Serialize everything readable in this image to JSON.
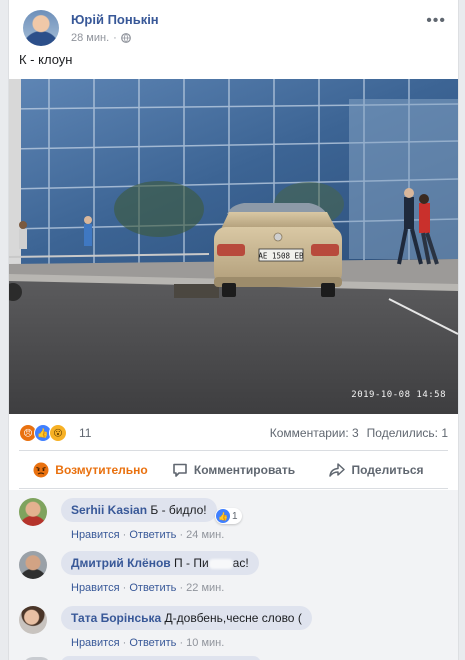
{
  "post": {
    "author": "Юрій Понькін",
    "time": "28 мин.",
    "text": "К - клоун",
    "photo_timestamp": "2019-10-08  14:58",
    "plate_text": "АЕ 1508 ЕВ"
  },
  "stats": {
    "reaction_count": "11",
    "comments": "Комментарии: 3",
    "shares": "Поделились: 1"
  },
  "actions": {
    "react": "Возмутительно",
    "comment": "Комментировать",
    "share": "Поделиться"
  },
  "comments": [
    {
      "name": "Serhii Kasian",
      "text_before": "Б - бидло!",
      "text_after": "",
      "reaction_count": "1",
      "like_label": "Нравится",
      "reply_label": "Ответить",
      "time": "24 мин."
    },
    {
      "name": "Дмитрий Клёнов",
      "text_before": "П - Пи",
      "text_after": "ас!",
      "like_label": "Нравится",
      "reply_label": "Ответить",
      "time": "22 мин."
    },
    {
      "name": "Тата Борінська",
      "text_before": "Д-довбень,чесне слово (",
      "text_after": "",
      "like_label": "Нравится",
      "reply_label": "Ответить",
      "time": "10 мин."
    }
  ],
  "separator": "·",
  "icons": [
    "globe-icon",
    "more-options-icon",
    "angry-reaction-icon",
    "like-reaction-icon",
    "wow-reaction-icon",
    "comment-icon",
    "share-icon"
  ],
  "colors": {
    "link": "#385898",
    "angry": "#e9710f",
    "like": "#4080ff",
    "wow": "#f7b125"
  }
}
